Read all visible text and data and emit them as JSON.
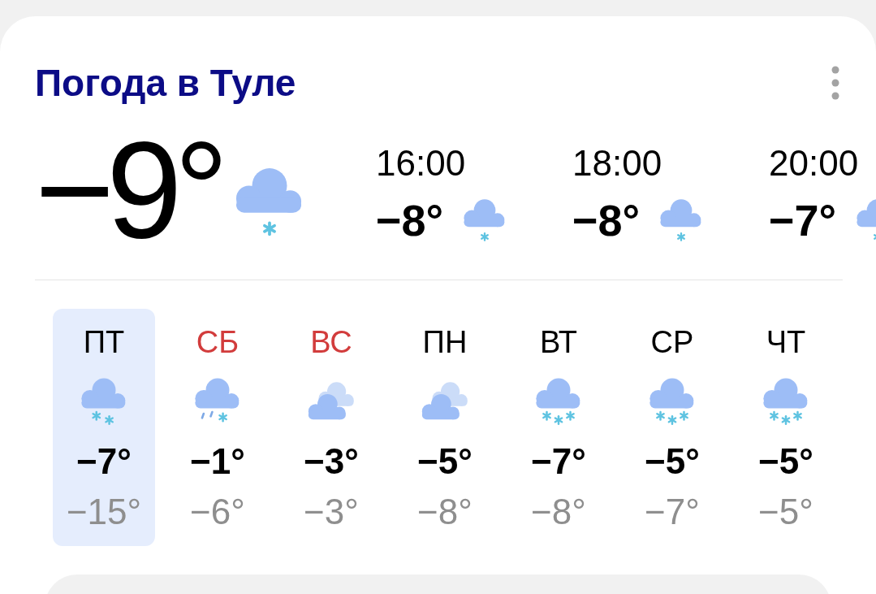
{
  "title": "Погода в Туле",
  "current": {
    "temperature": "−9°",
    "kind": "flurries"
  },
  "hourly": [
    {
      "time": "16:00",
      "temperature": "−8°",
      "kind": "flurries"
    },
    {
      "time": "18:00",
      "temperature": "−8°",
      "kind": "flurries"
    },
    {
      "time": "20:00",
      "temperature": "−7°",
      "kind": "flurries"
    }
  ],
  "days": [
    {
      "label": "ПТ",
      "weekend": false,
      "selected": true,
      "kind": "light-snow",
      "day_temperature": "−7°",
      "night_temperature": "−15°"
    },
    {
      "label": "СБ",
      "weekend": true,
      "selected": false,
      "kind": "sleet",
      "day_temperature": "−1°",
      "night_temperature": "−6°"
    },
    {
      "label": "ВС",
      "weekend": true,
      "selected": false,
      "kind": "overcast",
      "day_temperature": "−3°",
      "night_temperature": "−3°"
    },
    {
      "label": "ПН",
      "weekend": false,
      "selected": false,
      "kind": "overcast",
      "day_temperature": "−5°",
      "night_temperature": "−8°"
    },
    {
      "label": "ВТ",
      "weekend": false,
      "selected": false,
      "kind": "snow",
      "day_temperature": "−7°",
      "night_temperature": "−8°"
    },
    {
      "label": "СР",
      "weekend": false,
      "selected": false,
      "kind": "snow",
      "day_temperature": "−5°",
      "night_temperature": "−7°"
    },
    {
      "label": "ЧТ",
      "weekend": false,
      "selected": false,
      "kind": "snow",
      "day_temperature": "−5°",
      "night_temperature": "−5°"
    }
  ]
}
